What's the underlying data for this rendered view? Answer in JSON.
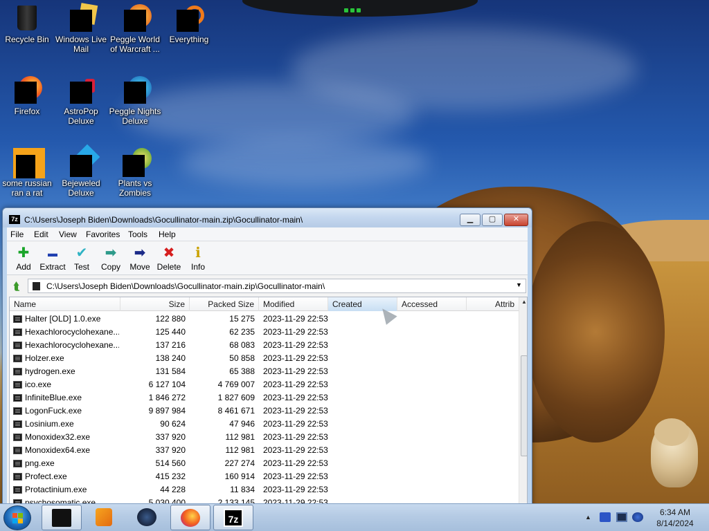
{
  "desktop": {
    "icons": [
      {
        "label": "Recycle Bin"
      },
      {
        "label": "Windows Live Mail"
      },
      {
        "label": "Peggle World of Warcraft ..."
      },
      {
        "label": "Everything"
      },
      {
        "label": "Firefox"
      },
      {
        "label": "AstroPop Deluxe"
      },
      {
        "label": "Peggle Nights Deluxe"
      },
      {
        "label": "some russian ran a rat"
      },
      {
        "label": "Bejeweled Deluxe"
      },
      {
        "label": "Plants vs Zombies"
      }
    ]
  },
  "window": {
    "app_icon": "7z",
    "title": "C:\\Users\\Joseph Biden\\Downloads\\Gocullinator-main.zip\\Gocullinator-main\\",
    "minimize_icon": "minimize-icon",
    "maximize_icon": "maximize-icon",
    "close_icon": "close-icon"
  },
  "menu": [
    "File",
    "Edit",
    "View",
    "Favorites",
    "Tools",
    "Help"
  ],
  "toolbar": [
    {
      "label": "Add",
      "icon": "plus-icon",
      "glyph": "✚",
      "color": "#1aa52a"
    },
    {
      "label": "Extract",
      "icon": "minus-icon",
      "glyph": "▬",
      "color": "#1f3fb0"
    },
    {
      "label": "Test",
      "icon": "check-icon",
      "glyph": "✔",
      "color": "#2fb3c4"
    },
    {
      "label": "Copy",
      "icon": "copy-arrow-icon",
      "glyph": "➡",
      "color": "#2d9a8a"
    },
    {
      "label": "Move",
      "icon": "move-arrow-icon",
      "glyph": "➡",
      "color": "#1b2a88"
    },
    {
      "label": "Delete",
      "icon": "delete-x-icon",
      "glyph": "✖",
      "color": "#d61f1f"
    },
    {
      "label": "Info",
      "icon": "info-icon",
      "glyph": "ℹ",
      "color": "#c9a100"
    }
  ],
  "address": {
    "path": "C:\\Users\\Joseph Biden\\Downloads\\Gocullinator-main.zip\\Gocullinator-main\\",
    "dropdown": "▼",
    "up_glyph": "⮬"
  },
  "columns": {
    "name": "Name",
    "size": "Size",
    "packed": "Packed Size",
    "modified": "Modified",
    "created": "Created",
    "accessed": "Accessed",
    "attrib": "Attrib"
  },
  "rows": [
    {
      "name": "Halter [OLD] 1.0.exe",
      "size": "122 880",
      "packed": "15 275",
      "modified": "2023-11-29 22:53"
    },
    {
      "name": "Hexachlorocyclohexane...",
      "size": "125 440",
      "packed": "62 235",
      "modified": "2023-11-29 22:53"
    },
    {
      "name": "Hexachlorocyclohexane...",
      "size": "137 216",
      "packed": "68 083",
      "modified": "2023-11-29 22:53"
    },
    {
      "name": "Holzer.exe",
      "size": "138 240",
      "packed": "50 858",
      "modified": "2023-11-29 22:53"
    },
    {
      "name": "hydrogen.exe",
      "size": "131 584",
      "packed": "65 388",
      "modified": "2023-11-29 22:53"
    },
    {
      "name": "ico.exe",
      "size": "6 127 104",
      "packed": "4 769 007",
      "modified": "2023-11-29 22:53"
    },
    {
      "name": "InfiniteBlue.exe",
      "size": "1 846 272",
      "packed": "1 827 609",
      "modified": "2023-11-29 22:53"
    },
    {
      "name": "LogonFuck.exe",
      "size": "9 897 984",
      "packed": "8 461 671",
      "modified": "2023-11-29 22:53"
    },
    {
      "name": "Losinium.exe",
      "size": "90 624",
      "packed": "47 946",
      "modified": "2023-11-29 22:53"
    },
    {
      "name": "Monoxidex32.exe",
      "size": "337 920",
      "packed": "112 981",
      "modified": "2023-11-29 22:53"
    },
    {
      "name": "Monoxidex64.exe",
      "size": "337 920",
      "packed": "112 981",
      "modified": "2023-11-29 22:53"
    },
    {
      "name": "png.exe",
      "size": "514 560",
      "packed": "227 274",
      "modified": "2023-11-29 22:53"
    },
    {
      "name": "Profect.exe",
      "size": "415 232",
      "packed": "160 914",
      "modified": "2023-11-29 22:53"
    },
    {
      "name": "Protactinium.exe",
      "size": "44 228",
      "packed": "11 834",
      "modified": "2023-11-29 22:53"
    },
    {
      "name": "psychosomatic.exe",
      "size": "5 030 400",
      "packed": "2 133 145",
      "modified": "2023-11-29 22:53"
    }
  ],
  "taskbar": {
    "apps": [
      {
        "name": "black-app-icon",
        "active": true
      },
      {
        "name": "media-player-icon",
        "active": false
      },
      {
        "name": "dark-globe-icon",
        "active": false
      },
      {
        "name": "firefox-icon",
        "active": true
      },
      {
        "name": "7zip-icon",
        "active": true,
        "text": "7z"
      }
    ],
    "tray_arrow": "▲",
    "time": "6:34 AM",
    "date": "8/14/2024"
  }
}
